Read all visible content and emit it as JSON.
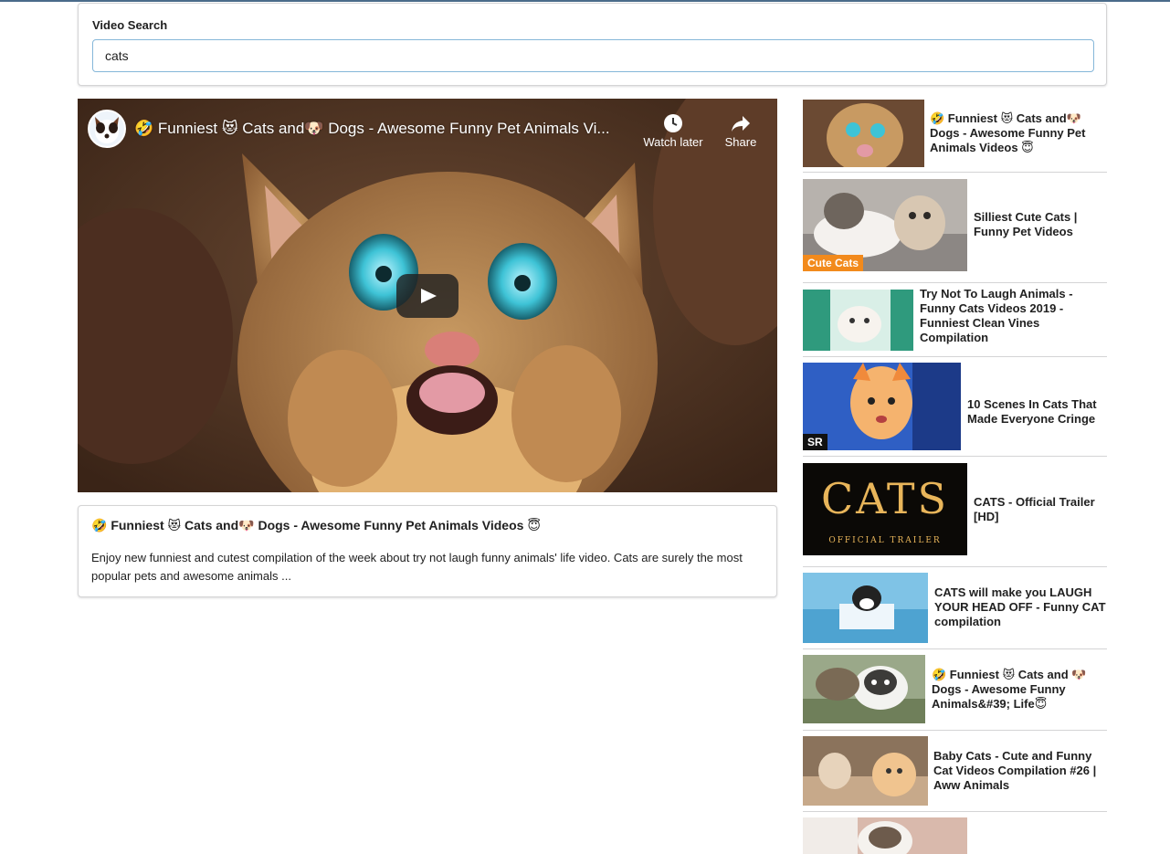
{
  "search": {
    "label": "Video Search",
    "value": "cats"
  },
  "player": {
    "title": "🤣 Funniest 😻 Cats and🐶 Dogs - Awesome Funny Pet Animals Vi...",
    "watch_later": "Watch later",
    "share": "Share",
    "icons": [
      "clock-icon",
      "share-arrow-icon",
      "play-icon"
    ]
  },
  "details": {
    "title": "🤣 Funniest 😻 Cats and🐶 Dogs - Awesome Funny Pet Animals Videos 😇",
    "description": "Enjoy new funniest and cutest compilation of the week about try not laugh funny animals' life video. Cats are surely the most popular pets and awesome animals ..."
  },
  "videos": [
    {
      "title": "🤣 Funniest 😻 Cats and🐶 Dogs - Awesome Funny Pet Animals Videos 😇"
    },
    {
      "title": "Silliest Cute Cats | Funny Pet Videos",
      "badge": "Cute Cats"
    },
    {
      "title": "Try Not To Laugh Animals - Funny Cats Videos 2019 - Funniest Clean Vines Compilation"
    },
    {
      "title": "10 Scenes In Cats That Made Everyone Cringe",
      "badge": "SR"
    },
    {
      "title": "CATS - Official Trailer [HD]",
      "thumb_text": "CATS",
      "thumb_sub": "OFFICIAL TRAILER"
    },
    {
      "title": "CATS will make you LAUGH YOUR HEAD OFF - Funny CAT compilation"
    },
    {
      "title": "🤣 Funniest 😻 Cats and 🐶 Dogs - Awesome Funny Animals&#39; Life😇"
    },
    {
      "title": "Baby Cats - Cute and Funny Cat Videos Compilation #26 | Aww Animals"
    },
    {
      "title": ""
    }
  ],
  "colors": {
    "accent": "#85b7d9",
    "border": "#d4d4d5",
    "text": "#212121",
    "badge_orange": "#f28a1c"
  }
}
